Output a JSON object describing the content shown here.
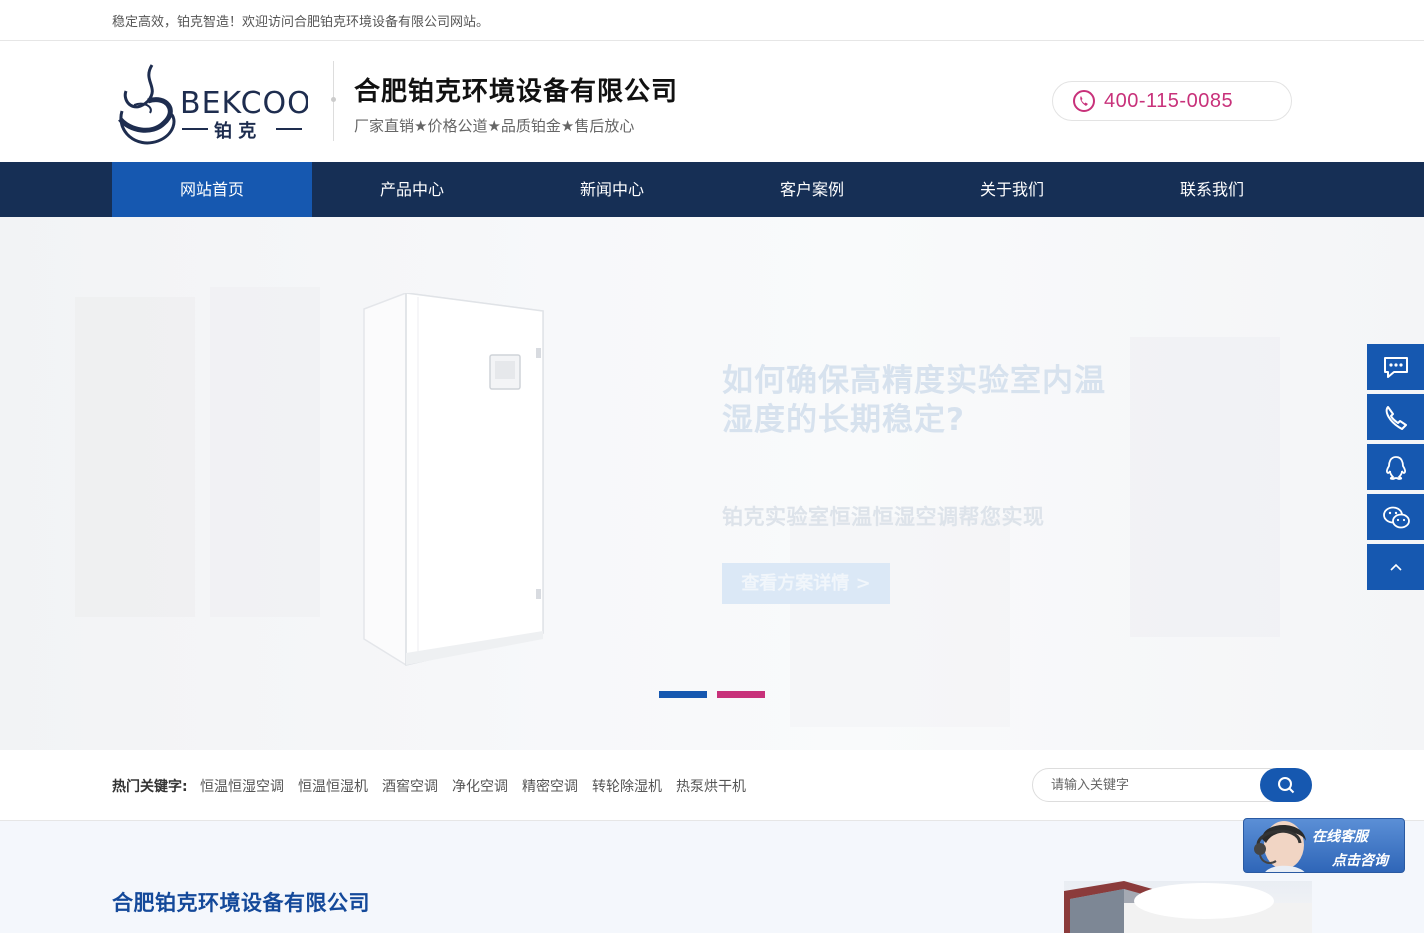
{
  "topbar": {
    "welcome": "稳定高效，铂克智造！欢迎访问合肥铂克环境设备有限公司网站。"
  },
  "header": {
    "logo_text": "BEKCOO",
    "logo_sub": "铂 克",
    "company_name": "合肥铂克环境设备有限公司",
    "slogan": "厂家直销★价格公道★品质铂金★售后放心",
    "phone": "400-115-0085"
  },
  "nav": {
    "items": [
      {
        "label": "网站首页",
        "active": true
      },
      {
        "label": "产品中心"
      },
      {
        "label": "新闻中心"
      },
      {
        "label": "客户案例"
      },
      {
        "label": "关于我们"
      },
      {
        "label": "联系我们"
      }
    ]
  },
  "banner": {
    "title": "如何确保高精度实验室内温湿度的长期稳定?",
    "subtitle": "铂克实验室恒温恒湿空调帮您实现",
    "button": "查看方案详情 >"
  },
  "keywords": {
    "label": "热门关键字:",
    "items": [
      "恒温恒湿空调",
      "恒温恒湿机",
      "酒窖空调",
      "净化空调",
      "精密空调",
      "转轮除湿机",
      "热泵烘干机"
    ]
  },
  "search": {
    "placeholder": "请输入关键字"
  },
  "side": {
    "icons": [
      "chat-icon",
      "phone-icon",
      "qq-icon",
      "wechat-icon",
      "back-to-top-icon"
    ]
  },
  "service": {
    "line1": "在线客服",
    "line2": "点击咨询"
  },
  "section": {
    "title": "合肥铂克环境设备有限公司"
  },
  "colors": {
    "nav_bg": "#162f55",
    "accent_blue": "#1658b0",
    "accent_pink": "#c8317a",
    "section_title": "#14499a"
  }
}
